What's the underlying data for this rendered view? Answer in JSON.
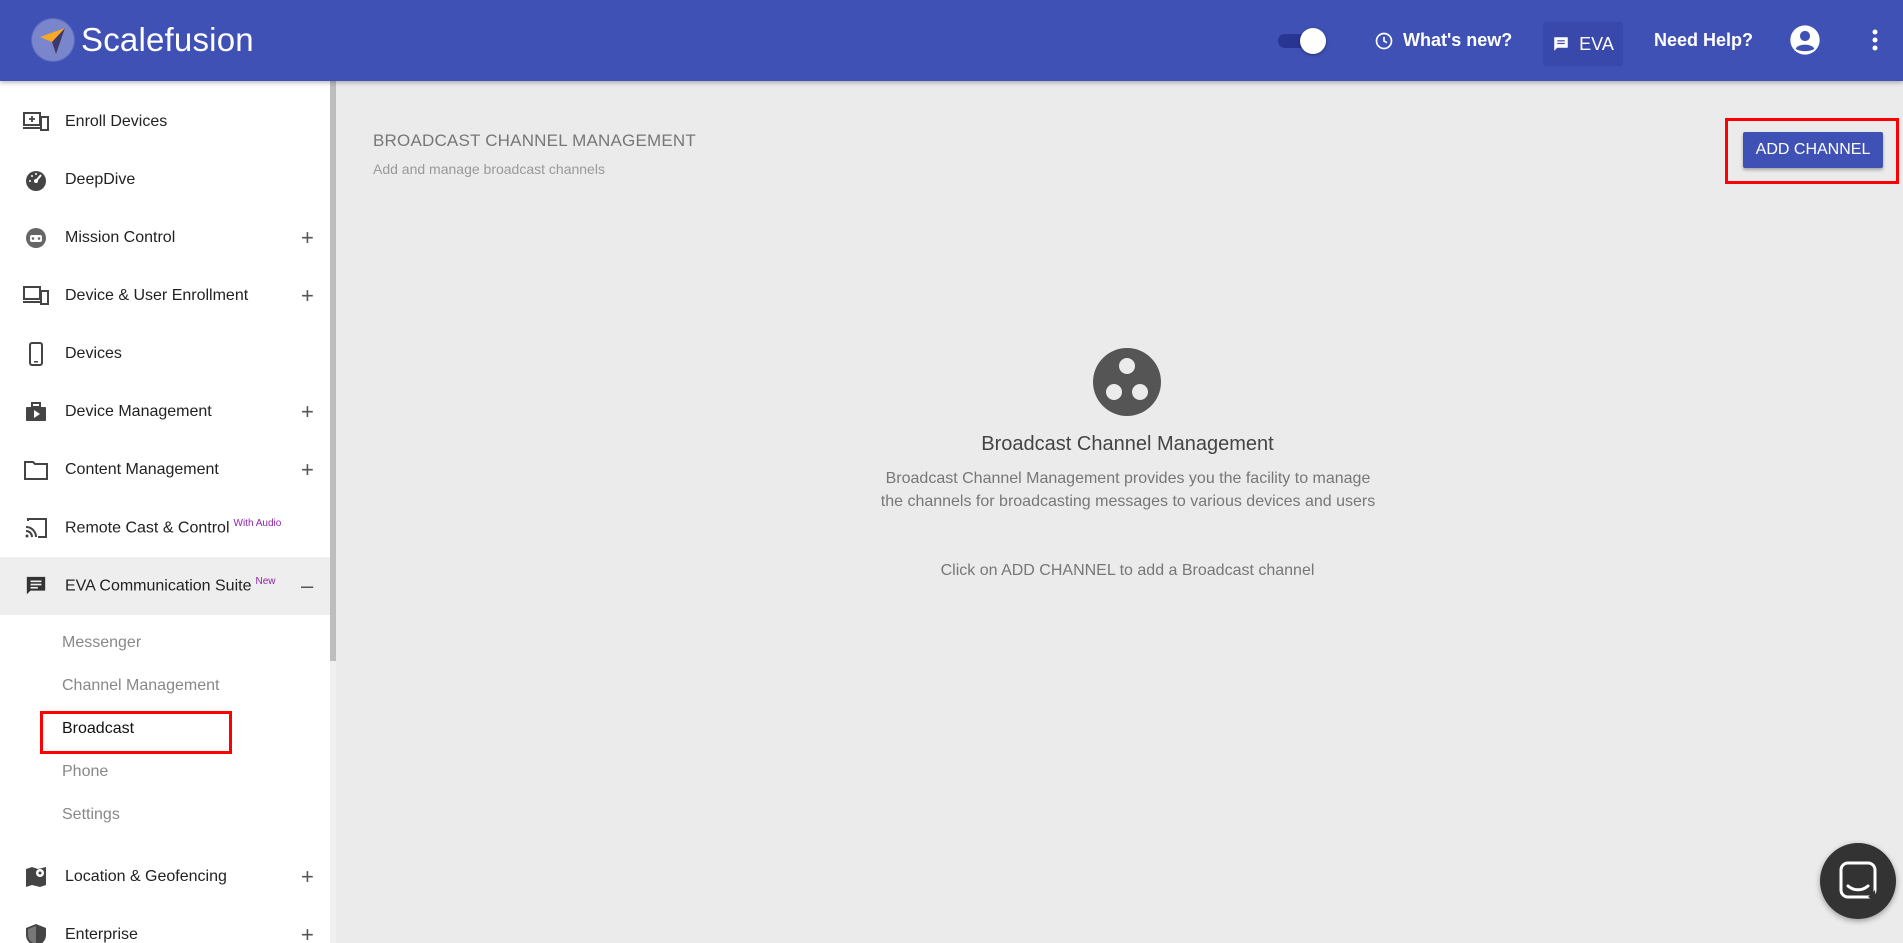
{
  "header": {
    "app_name": "Scalefusion",
    "whats_new": "What's new?",
    "eva": "EVA",
    "need_help": "Need Help?"
  },
  "sidebar": {
    "items": [
      {
        "label": "Enroll Devices",
        "icon": "enroll-devices-icon",
        "expandable": false
      },
      {
        "label": "DeepDive",
        "icon": "speedometer-icon",
        "expandable": false
      },
      {
        "label": "Mission Control",
        "icon": "mission-control-icon",
        "expandable": true
      },
      {
        "label": "Device & User Enrollment",
        "icon": "devices-enrollment-icon",
        "expandable": true
      },
      {
        "label": "Devices",
        "icon": "phone-icon",
        "expandable": false
      },
      {
        "label": "Device Management",
        "icon": "briefcase-icon",
        "expandable": true
      },
      {
        "label": "Content Management",
        "icon": "folder-icon",
        "expandable": true
      },
      {
        "label": "Remote Cast & Control",
        "icon": "cast-icon",
        "badge": "With Audio",
        "expandable": false
      },
      {
        "label": "EVA Communication Suite",
        "icon": "chat-icon",
        "badge": "New",
        "expanded": true
      },
      {
        "label": "Location & Geofencing",
        "icon": "map-pin-icon",
        "expandable": true
      },
      {
        "label": "Enterprise",
        "icon": "shield-icon",
        "expandable": true
      }
    ],
    "eva_sub_items": [
      "Messenger",
      "Channel Management",
      "Broadcast",
      "Phone",
      "Settings"
    ],
    "current_sub_item": "Broadcast"
  },
  "main": {
    "title": "BROADCAST CHANNEL MANAGEMENT",
    "subtitle": "Add and manage broadcast channels",
    "add_button": "ADD CHANNEL",
    "empty_state": {
      "title": "Broadcast Channel Management",
      "description": "Broadcast Channel Management provides you the facility to manage the channels for broadcasting messages to various devices and users",
      "hint": "Click on ADD CHANNEL to add a Broadcast channel"
    }
  },
  "colors": {
    "header": "#3f51b5",
    "accent": "#3f51b5",
    "highlight": "#ff0000",
    "background": "#ebebeb"
  }
}
